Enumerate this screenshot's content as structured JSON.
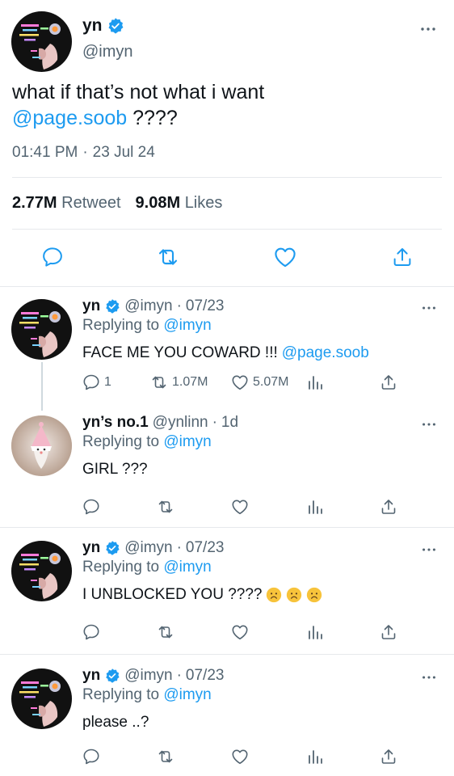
{
  "main_tweet": {
    "name": "yn",
    "handle": "@imyn",
    "text_prefix": "what if that’s not what i want",
    "mention": "@page.soob",
    "text_suffix": " ????",
    "time": "01:41 PM",
    "dot": "·",
    "date": "23 Jul 24",
    "retweet_count": "2.77M",
    "retweet_label": "Retweet",
    "likes_count": "9.08M",
    "likes_label": "Likes"
  },
  "replies": [
    {
      "name": "yn",
      "verified": true,
      "handle": "@imyn",
      "dot": "·",
      "date": "07/23",
      "replying_label": "Replying to",
      "replying_to": "@imyn",
      "text": "FACE ME YOU COWARD !!!",
      "mention": "@page.soob",
      "reply_count": "1",
      "retweet_count": "1.07M",
      "like_count": "5.07M"
    },
    {
      "name": "yn’s no.1",
      "verified": false,
      "handle": "@ynlinn",
      "dot": "·",
      "date": "1d",
      "replying_label": "Replying to",
      "replying_to": "@imyn",
      "text": "GIRL ???"
    },
    {
      "name": "yn",
      "verified": true,
      "handle": "@imyn",
      "dot": "·",
      "date": "07/23",
      "replying_label": "Replying to",
      "replying_to": "@imyn",
      "text": "I UNBLOCKED YOU ????",
      "emojis": [
        "slightly-frowning-face",
        "slightly-frowning-face",
        "slightly-frowning-face"
      ]
    },
    {
      "name": "yn",
      "verified": true,
      "handle": "@imyn",
      "dot": "·",
      "date": "07/23",
      "replying_label": "Replying to",
      "replying_to": "@imyn",
      "text": "please ..?"
    }
  ],
  "colors": {
    "accent": "#1d9bf0",
    "text": "#0f1419",
    "secondary": "#536471",
    "divider": "#e6e9ec"
  },
  "icons": [
    "more-icon",
    "verified-icon",
    "reply-icon",
    "retweet-icon",
    "like-icon",
    "share-icon",
    "analytics-icon"
  ]
}
